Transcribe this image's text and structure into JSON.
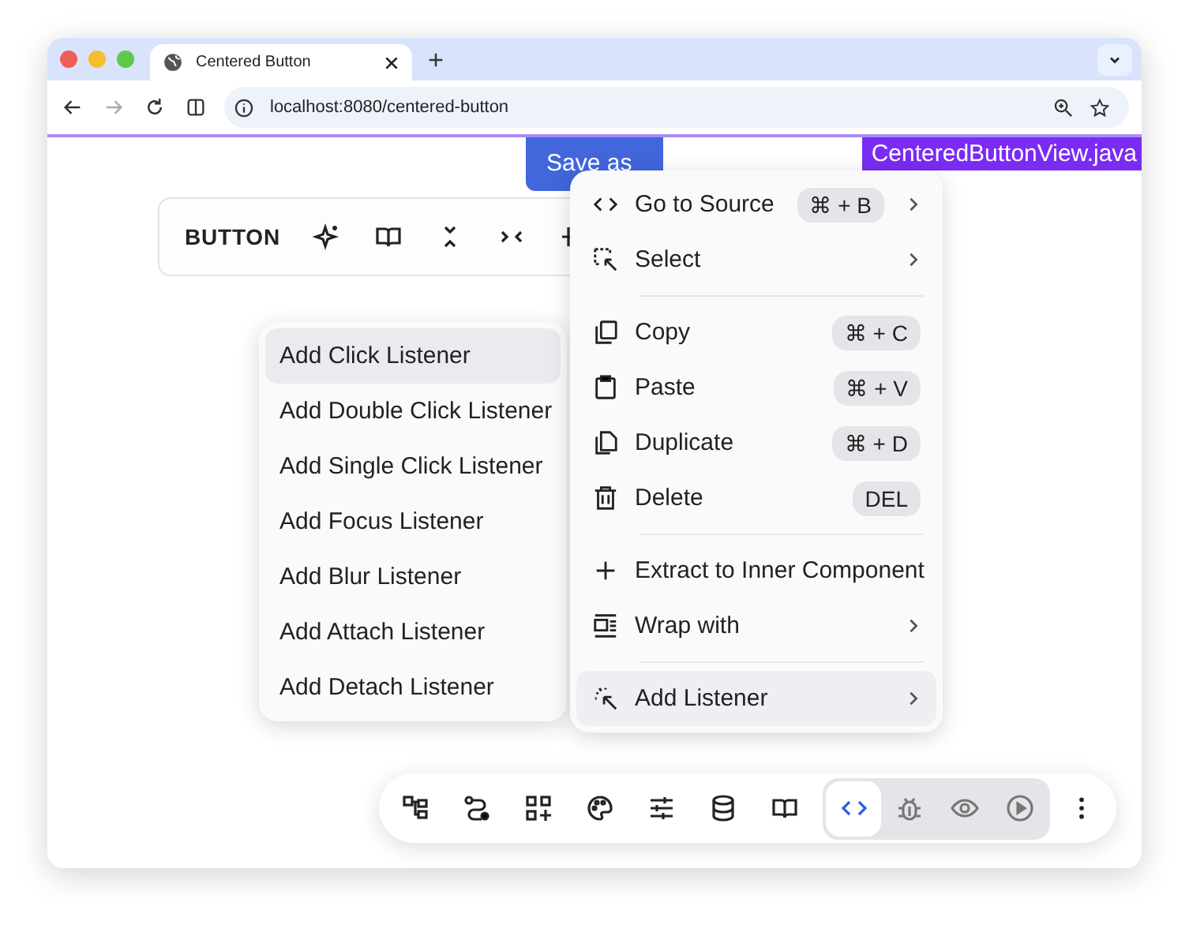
{
  "browser": {
    "tab": {
      "title": "Centered Button"
    },
    "url": "localhost:8080/centered-button"
  },
  "page": {
    "save_button": "Save as",
    "file_badge": "CenteredButtonView.java"
  },
  "element_toolbar": {
    "label": "BUTTON"
  },
  "context_menu": {
    "groups": [
      [
        {
          "label": "Go to Source",
          "shortcut": "⌘ + B",
          "submenu": true,
          "selected": false
        },
        {
          "label": "Select",
          "submenu": true,
          "selected": false
        }
      ],
      [
        {
          "label": "Copy",
          "shortcut": "⌘ + C",
          "submenu": false,
          "selected": false
        },
        {
          "label": "Paste",
          "shortcut": "⌘ + V",
          "submenu": false,
          "selected": false
        },
        {
          "label": "Duplicate",
          "shortcut": "⌘ + D",
          "submenu": false,
          "selected": false
        },
        {
          "label": "Delete",
          "shortcut": "DEL",
          "submenu": false,
          "selected": false
        }
      ],
      [
        {
          "label": "Extract to Inner Component",
          "submenu": false,
          "selected": false
        },
        {
          "label": "Wrap with",
          "submenu": true,
          "selected": false
        }
      ],
      [
        {
          "label": "Add Listener",
          "submenu": true,
          "selected": true
        }
      ]
    ]
  },
  "submenu": {
    "items": [
      {
        "label": "Add Click Listener",
        "selected": true
      },
      {
        "label": "Add Double Click Listener",
        "selected": false
      },
      {
        "label": "Add Single Click Listener",
        "selected": false
      },
      {
        "label": "Add Focus Listener",
        "selected": false
      },
      {
        "label": "Add Blur Listener",
        "selected": false
      },
      {
        "label": "Add Attach Listener",
        "selected": false
      },
      {
        "label": "Add Detach Listener",
        "selected": false
      }
    ]
  },
  "bottom_toolbar": {
    "modes": [
      {
        "selected": true
      },
      {
        "selected": false
      },
      {
        "selected": false
      },
      {
        "selected": false
      }
    ]
  }
}
